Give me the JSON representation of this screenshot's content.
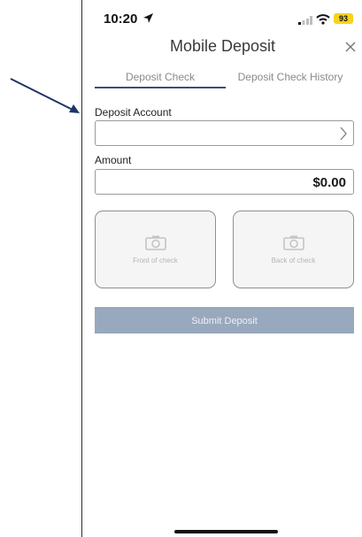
{
  "status_bar": {
    "time": "10:20",
    "battery": "93"
  },
  "header": {
    "title": "Mobile Deposit"
  },
  "tabs": [
    {
      "label": "Deposit Check",
      "active": true
    },
    {
      "label": "Deposit Check History",
      "active": false
    }
  ],
  "form": {
    "account_label": "Deposit Account",
    "account_value": "",
    "amount_label": "Amount",
    "amount_value": "$0.00"
  },
  "check_images": {
    "front_label": "Front of check",
    "back_label": "Back of check"
  },
  "submit_label": "Submit Deposit",
  "colors": {
    "accent": "#3b4d76",
    "submit_disabled": "#98a8bd",
    "battery": "#f4d41c",
    "annotation_arrow": "#1f3466"
  },
  "icons": [
    "location-arrow-icon",
    "signal-icon",
    "wifi-icon",
    "battery-icon",
    "close-icon",
    "chevron-right-icon",
    "camera-icon"
  ]
}
